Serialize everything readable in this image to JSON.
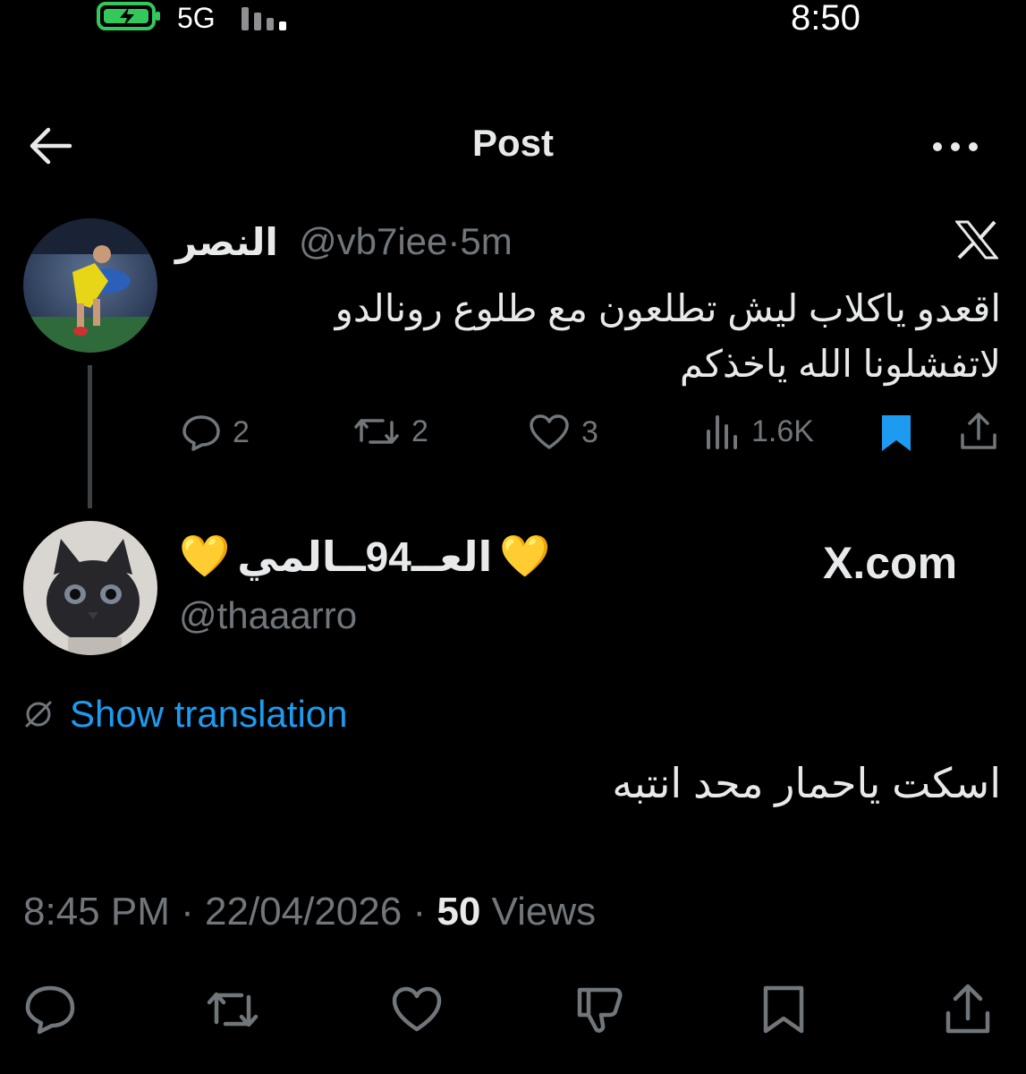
{
  "status_bar": {
    "network": "5G",
    "time": "8:50"
  },
  "header": {
    "title": "Post",
    "back_icon": "arrow-left-icon",
    "more_icon": "more-horizontal-icon"
  },
  "quoted_post": {
    "display_name": "النصر",
    "handle": "@vb7iee",
    "separator": "·",
    "time_ago": "5m",
    "watermark": "X",
    "text_line1": "اقعدو ياكلاب ليش تطلعون مع طلوع رونالدو",
    "text_line2": "لاتفشلونا الله ياخذكم",
    "replies": "2",
    "reposts": "2",
    "likes": "3",
    "views": "1.6K"
  },
  "main_post": {
    "display_name": "العــ94ــالمي",
    "emoji": "💛",
    "handle": "@thaaarro",
    "watermark": "X.com",
    "translate_label": "Show translation",
    "text": "اسكت ياحمار محد انتبه",
    "time": "8:45 PM",
    "date": "22/04/2026",
    "separator": "·",
    "views_count": "50",
    "views_label": "Views"
  },
  "colors": {
    "accent": "#1d9bf0",
    "muted": "#71767b",
    "text": "#e7e9ea",
    "battery": "#34c759"
  }
}
